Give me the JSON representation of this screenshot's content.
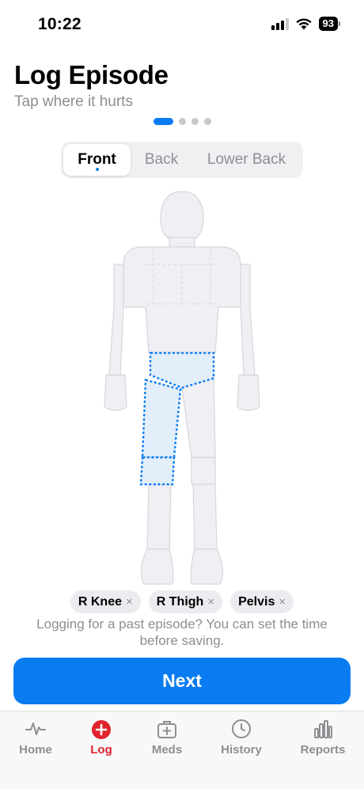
{
  "status_bar": {
    "time": "10:22",
    "battery": "93"
  },
  "header": {
    "title": "Log Episode",
    "subtitle": "Tap where it hurts"
  },
  "pager": {
    "total": 4,
    "current": 1
  },
  "view_selector": {
    "options": [
      "Front",
      "Back",
      "Lower Back"
    ],
    "selected": "Front"
  },
  "selected_regions": [
    {
      "label": "R Knee",
      "remove": "×"
    },
    {
      "label": "R Thigh",
      "remove": "×"
    },
    {
      "label": "Pelvis",
      "remove": "×"
    }
  ],
  "note": "Logging for a past episode? You can set the time before saving.",
  "next_label": "Next",
  "tab_bar": {
    "tabs": [
      {
        "label": "Home",
        "icon": "pulse-icon"
      },
      {
        "label": "Log",
        "icon": "plus-circle-icon",
        "active": true
      },
      {
        "label": "Meds",
        "icon": "medkit-icon"
      },
      {
        "label": "History",
        "icon": "clock-icon"
      },
      {
        "label": "Reports",
        "icon": "bar-chart-icon"
      }
    ]
  },
  "colors": {
    "accent": "#0a7cf2",
    "active_tab": "#e0232e",
    "body_fill": "#efeff4",
    "selected_region_fill": "#e3eefb"
  }
}
